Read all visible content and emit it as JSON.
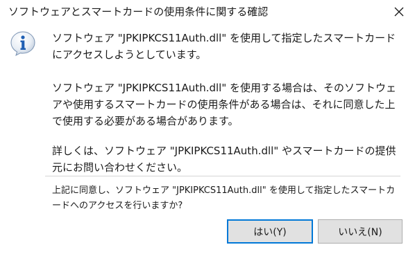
{
  "dialog": {
    "title": "ソフトウェアとスマートカードの使用条件に関する確認",
    "close_label": "✕",
    "message_1": "ソフトウェア \"JPKIPKCS11Auth.dll\" を使用して指定したスマートカードにアクセスしようとしています。",
    "message_2": "ソフトウェア \"JPKIPKCS11Auth.dll\" を使用する場合は、そのソフトウェアや使用するスマートカードの使用条件がある場合は、それに同意した上で使用する必要がある場合があります。",
    "message_3": "詳しくは、ソフトウェア \"JPKIPKCS11Auth.dll\" やスマートカードの提供元にお問い合わせください。",
    "question": "上記に同意し、ソフトウェア \"JPKIPKCS11Auth.dll\" を使用して指定したスマートカードへのアクセスを行いますか?",
    "yes_label": "はい(Y)",
    "no_label": "いいえ(N)",
    "icon": "info-icon",
    "accent_color": "#0078d7"
  }
}
